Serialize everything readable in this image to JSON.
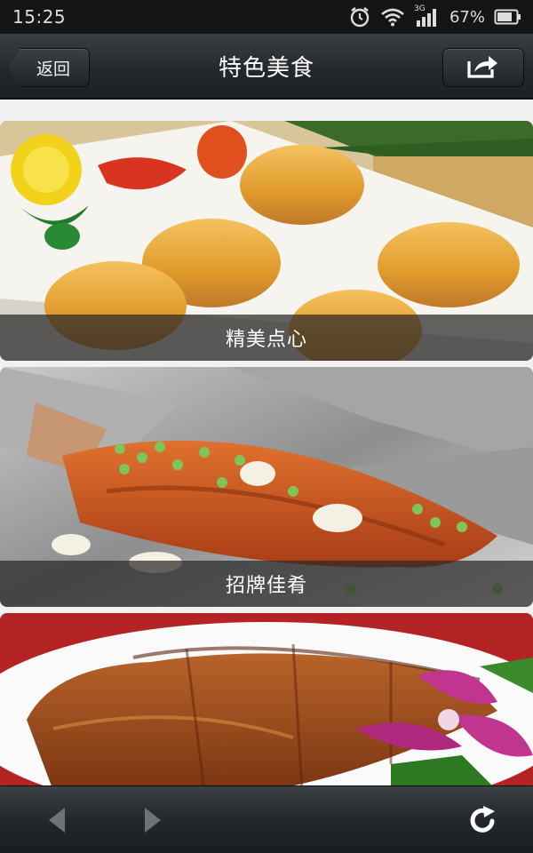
{
  "status_bar": {
    "time": "15:25",
    "battery_percent": "67%",
    "network_label": "3G",
    "icons": [
      "alarm-icon",
      "wifi-icon",
      "signal-icon",
      "battery-icon"
    ]
  },
  "header": {
    "title": "特色美食",
    "back_label": "返回",
    "share_icon": "share-icon"
  },
  "cards": [
    {
      "caption": "精美点心",
      "image": "pastry-photo"
    },
    {
      "caption": "招牌佳肴",
      "image": "fish-photo"
    },
    {
      "caption": "",
      "image": "braised-meat-photo"
    }
  ],
  "toolbar": {
    "icons": [
      "back-arrow-icon",
      "forward-arrow-icon",
      "refresh-icon"
    ]
  },
  "colors": {
    "header_bg": "#25292d",
    "status_bg": "#151515",
    "page_bg": "#f1f1f1",
    "caption_bg": "rgba(40,40,40,0.72)"
  }
}
